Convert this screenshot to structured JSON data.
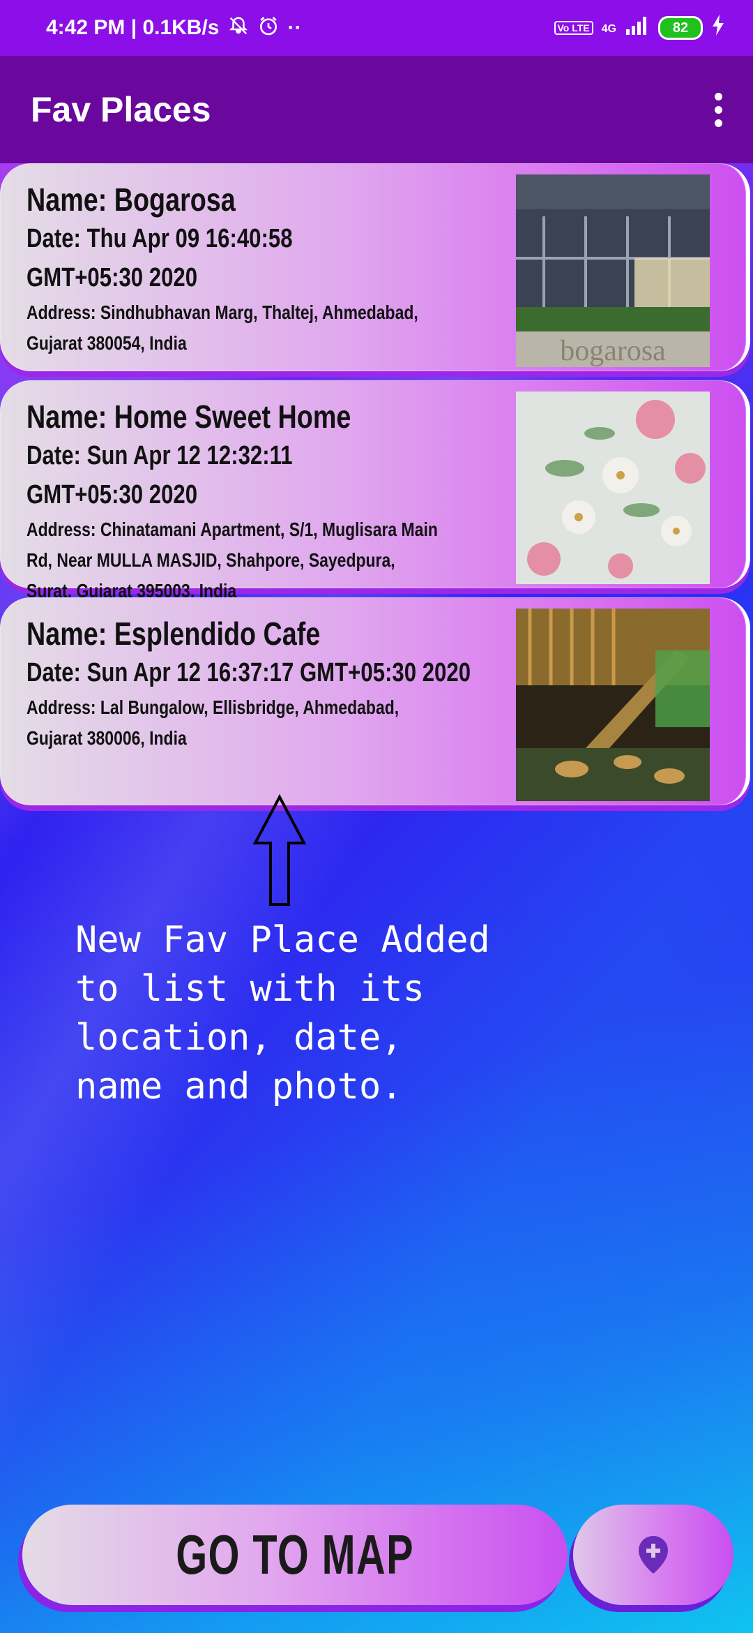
{
  "status_bar": {
    "time_speed": "4:42 PM | 0.1KB/s",
    "network": "4G",
    "volte": "Vo LTE",
    "battery": "82"
  },
  "app_bar": {
    "title": "Fav Places"
  },
  "places": [
    {
      "name": "Name: Bogarosa",
      "date": "Date: Thu Apr 09 16:40:58 GMT+05:30 2020",
      "address": "Address: Sindhubhavan Marg, Thaltej, Ahmedabad, Gujarat 380054, India",
      "photo_label": "bogarosa"
    },
    {
      "name": "Name: Home Sweet Home",
      "date": "Date: Sun Apr 12 12:32:11 GMT+05:30 2020",
      "address": "Address: Chinatamani Apartment, S/1, Muglisara Main Rd, Near MULLA MASJID, Shahpore, Sayedpura, Surat, Gujarat 395003, India"
    },
    {
      "name": "Name: Esplendido Cafe",
      "date": "Date: Sun Apr 12 16:37:17 GMT+05:30 2020",
      "address": "Address: Lal Bungalow, Ellisbridge, Ahmedabad, Gujarat 380006, India"
    }
  ],
  "annotation": "New Fav Place Added\nto list with its\nlocation, date,\nname and photo.",
  "buttons": {
    "go_to_map": "GO TO MAP"
  },
  "icons": {
    "add_place": "add-location-icon",
    "overflow": "more-vert-icon",
    "arrow": "up-arrow-icon"
  },
  "colors": {
    "status_bar": "#8c0ee8",
    "app_bar": "#6a079c",
    "card_start": "#e4dde6",
    "card_end": "#cc4ff0"
  }
}
